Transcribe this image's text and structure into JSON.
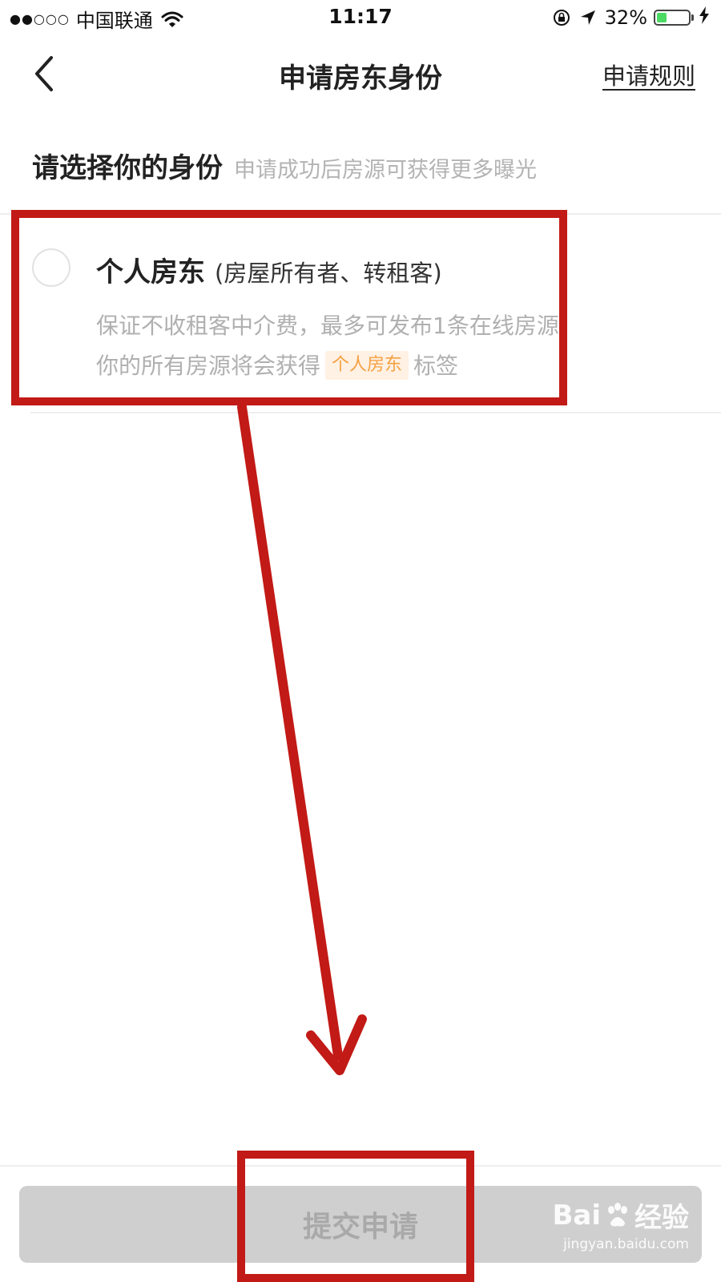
{
  "status_bar": {
    "signal": "●●○○○",
    "carrier": "中国联通",
    "time": "11:17",
    "battery": "32%",
    "battery_level": 0.32,
    "battery_color": "#4cd964"
  },
  "nav": {
    "back_icon": "chevron-left-icon",
    "title": "申请房东身份",
    "rules_link": "申请规则"
  },
  "section": {
    "title": "请选择你的身份",
    "subtitle": "申请成功后房源可获得更多曝光"
  },
  "option": {
    "title": "个人房东",
    "note": "(房屋所有者、转租客)",
    "desc_line1": "保证不收租客中介费，最多可发布1条在线房源。",
    "desc_line2_prefix": "你的所有房源将会获得",
    "tag": "个人房东",
    "desc_line2_suffix": "标签",
    "selected": false
  },
  "submit": {
    "label": "提交申请"
  },
  "watermark": {
    "brand_left": "Bai",
    "brand_right": "经验",
    "url": "jingyan.baidu.com"
  },
  "colors": {
    "annotation": "#c21a16",
    "tag_bg": "#fff1e3",
    "tag_text": "#f5a142",
    "disabled_button": "#cfcfcf"
  }
}
